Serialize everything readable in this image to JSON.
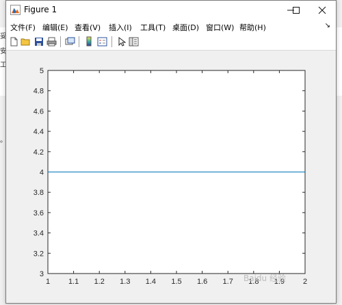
{
  "window": {
    "title": "Figure 1",
    "minimize_icon": "minimize-icon",
    "maximize_icon": "maximize-icon",
    "close_icon": "close-icon"
  },
  "menu": {
    "items": [
      "文件(F)",
      "编辑(E)",
      "查看(V)",
      "插入(I)",
      "工具(T)",
      "桌面(D)",
      "窗口(W)",
      "帮助(H)"
    ],
    "overflow_arrow": "↘"
  },
  "toolbar": {
    "icons": [
      "new-figure-icon",
      "open-file-icon",
      "save-icon",
      "print-icon",
      "link-plot-icon",
      "colorbar-icon",
      "legend-icon",
      "pointer-icon",
      "property-editor-icon"
    ]
  },
  "background": {
    "fragments": [
      "妥",
      "安",
      "工",
      "。"
    ]
  },
  "watermark": "Baidu 经验",
  "colors": {
    "line": "#0072bd",
    "axes_bg": "#ffffff",
    "figure_bg": "#f0f0f0"
  },
  "chart_data": {
    "type": "line",
    "title": "",
    "xlabel": "",
    "ylabel": "",
    "xlim": [
      1,
      2
    ],
    "ylim": [
      3,
      5
    ],
    "xticks": [
      "1",
      "1.1",
      "1.2",
      "1.3",
      "1.4",
      "1.5",
      "1.6",
      "1.7",
      "1.8",
      "1.9",
      "2"
    ],
    "yticks": [
      "3",
      "3.2",
      "3.4",
      "3.6",
      "3.8",
      "4",
      "4.2",
      "4.4",
      "4.6",
      "4.8",
      "5"
    ],
    "grid": false,
    "series": [
      {
        "x": [
          1,
          2
        ],
        "y": [
          4,
          4
        ]
      }
    ]
  }
}
